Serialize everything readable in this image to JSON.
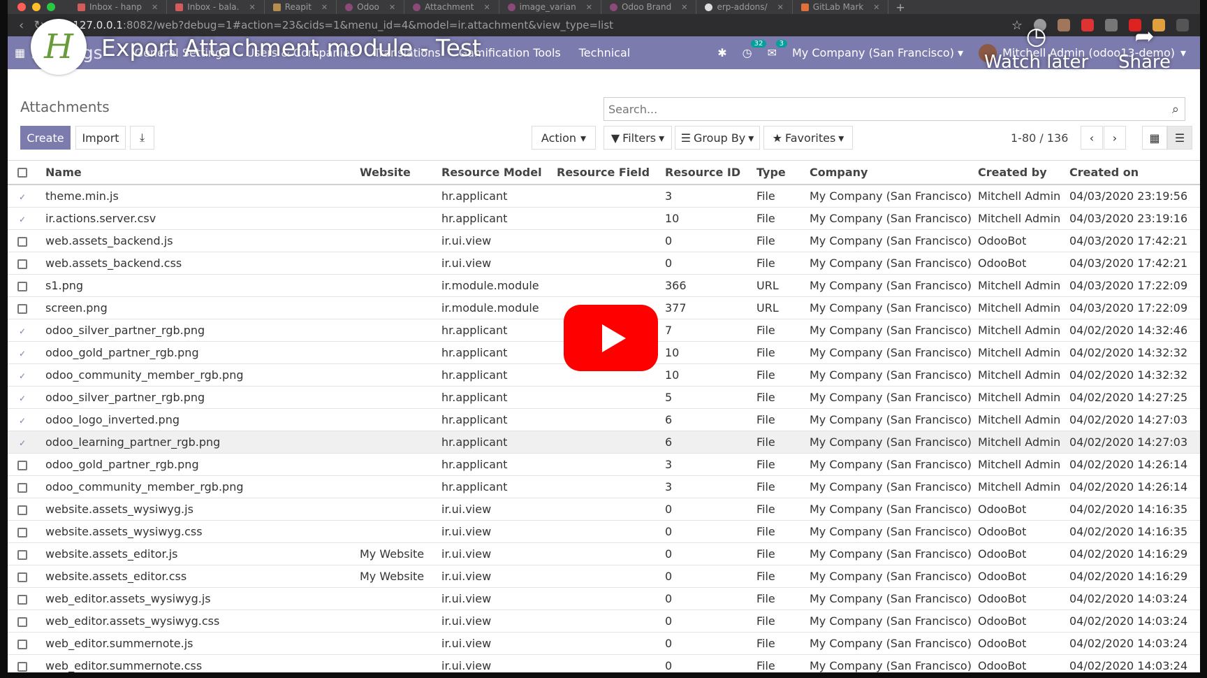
{
  "browser": {
    "tabs": [
      "Inbox - hanp",
      "Inbox - bala.",
      "Reapit",
      "Odoo",
      "Attachment",
      "image_varian",
      "Odoo Brand",
      "erp-addons/",
      "GitLab Mark"
    ],
    "url_host": "127.0.0.1",
    "url_rest": ":8082/web?debug=1#action=23&cids=1&menu_id=4&model=ir.attachment&view_type=list"
  },
  "navbar": {
    "brand": "Settings",
    "menu": [
      "General Settings",
      "Users & Companies",
      "Translations",
      "Gamification Tools",
      "Technical"
    ],
    "activity_count": "32",
    "messages_count": "3",
    "company": "My Company (San Francisco)",
    "user": "Mitchell Admin (odoo13-demo)"
  },
  "control_panel": {
    "breadcrumb": "Attachments",
    "search_placeholder": "Search...",
    "create_label": "Create",
    "import_label": "Import",
    "action_label": "Action",
    "filters_label": "Filters",
    "groupby_label": "Group By",
    "favorites_label": "Favorites",
    "pager": "1-80 / 136"
  },
  "table": {
    "columns": [
      "Name",
      "Website",
      "Resource Model",
      "Resource Field",
      "Resource ID",
      "Type",
      "Company",
      "Created by",
      "Created on"
    ],
    "rows": [
      {
        "checked": true,
        "name": "theme.min.js",
        "website": "",
        "model": "hr.applicant",
        "field": "",
        "res_id": "3",
        "type": "File",
        "company": "My Company (San Francisco)",
        "created_by": "Mitchell Admin",
        "created_on": "04/03/2020 23:19:56"
      },
      {
        "checked": true,
        "name": "ir.actions.server.csv",
        "website": "",
        "model": "hr.applicant",
        "field": "",
        "res_id": "10",
        "type": "File",
        "company": "My Company (San Francisco)",
        "created_by": "Mitchell Admin",
        "created_on": "04/03/2020 23:19:16"
      },
      {
        "checked": false,
        "name": "web.assets_backend.js",
        "website": "",
        "model": "ir.ui.view",
        "field": "",
        "res_id": "0",
        "type": "File",
        "company": "My Company (San Francisco)",
        "created_by": "OdooBot",
        "created_on": "04/03/2020 17:42:21"
      },
      {
        "checked": false,
        "name": "web.assets_backend.css",
        "website": "",
        "model": "ir.ui.view",
        "field": "",
        "res_id": "0",
        "type": "File",
        "company": "My Company (San Francisco)",
        "created_by": "OdooBot",
        "created_on": "04/03/2020 17:42:21"
      },
      {
        "checked": false,
        "name": "s1.png",
        "website": "",
        "model": "ir.module.module",
        "field": "",
        "res_id": "366",
        "type": "URL",
        "company": "My Company (San Francisco)",
        "created_by": "Mitchell Admin",
        "created_on": "04/03/2020 17:22:09"
      },
      {
        "checked": false,
        "name": "screen.png",
        "website": "",
        "model": "ir.module.module",
        "field": "",
        "res_id": "377",
        "type": "URL",
        "company": "My Company (San Francisco)",
        "created_by": "Mitchell Admin",
        "created_on": "04/03/2020 17:22:09"
      },
      {
        "checked": true,
        "name": "odoo_silver_partner_rgb.png",
        "website": "",
        "model": "hr.applicant",
        "field": "",
        "res_id": "7",
        "type": "File",
        "company": "My Company (San Francisco)",
        "created_by": "Mitchell Admin",
        "created_on": "04/02/2020 14:32:46"
      },
      {
        "checked": true,
        "name": "odoo_gold_partner_rgb.png",
        "website": "",
        "model": "hr.applicant",
        "field": "",
        "res_id": "10",
        "type": "File",
        "company": "My Company (San Francisco)",
        "created_by": "Mitchell Admin",
        "created_on": "04/02/2020 14:32:32"
      },
      {
        "checked": true,
        "name": "odoo_community_member_rgb.png",
        "website": "",
        "model": "hr.applicant",
        "field": "",
        "res_id": "10",
        "type": "File",
        "company": "My Company (San Francisco)",
        "created_by": "Mitchell Admin",
        "created_on": "04/02/2020 14:32:32"
      },
      {
        "checked": true,
        "name": "odoo_silver_partner_rgb.png",
        "website": "",
        "model": "hr.applicant",
        "field": "",
        "res_id": "5",
        "type": "File",
        "company": "My Company (San Francisco)",
        "created_by": "Mitchell Admin",
        "created_on": "04/02/2020 14:27:25"
      },
      {
        "checked": true,
        "name": "odoo_logo_inverted.png",
        "website": "",
        "model": "hr.applicant",
        "field": "",
        "res_id": "6",
        "type": "File",
        "company": "My Company (San Francisco)",
        "created_by": "Mitchell Admin",
        "created_on": "04/02/2020 14:27:03"
      },
      {
        "checked": true,
        "name": "odoo_learning_partner_rgb.png",
        "website": "",
        "model": "hr.applicant",
        "field": "",
        "res_id": "6",
        "type": "File",
        "company": "My Company (San Francisco)",
        "created_by": "Mitchell Admin",
        "created_on": "04/02/2020 14:27:03"
      },
      {
        "checked": false,
        "name": "odoo_gold_partner_rgb.png",
        "website": "",
        "model": "hr.applicant",
        "field": "",
        "res_id": "3",
        "type": "File",
        "company": "My Company (San Francisco)",
        "created_by": "Mitchell Admin",
        "created_on": "04/02/2020 14:26:14"
      },
      {
        "checked": false,
        "name": "odoo_community_member_rgb.png",
        "website": "",
        "model": "hr.applicant",
        "field": "",
        "res_id": "3",
        "type": "File",
        "company": "My Company (San Francisco)",
        "created_by": "Mitchell Admin",
        "created_on": "04/02/2020 14:26:14"
      },
      {
        "checked": false,
        "name": "website.assets_wysiwyg.js",
        "website": "",
        "model": "ir.ui.view",
        "field": "",
        "res_id": "0",
        "type": "File",
        "company": "My Company (San Francisco)",
        "created_by": "OdooBot",
        "created_on": "04/02/2020 14:16:35"
      },
      {
        "checked": false,
        "name": "website.assets_wysiwyg.css",
        "website": "",
        "model": "ir.ui.view",
        "field": "",
        "res_id": "0",
        "type": "File",
        "company": "My Company (San Francisco)",
        "created_by": "OdooBot",
        "created_on": "04/02/2020 14:16:35"
      },
      {
        "checked": false,
        "name": "website.assets_editor.js",
        "website": "My Website",
        "model": "ir.ui.view",
        "field": "",
        "res_id": "0",
        "type": "File",
        "company": "My Company (San Francisco)",
        "created_by": "OdooBot",
        "created_on": "04/02/2020 14:16:29"
      },
      {
        "checked": false,
        "name": "website.assets_editor.css",
        "website": "My Website",
        "model": "ir.ui.view",
        "field": "",
        "res_id": "0",
        "type": "File",
        "company": "My Company (San Francisco)",
        "created_by": "OdooBot",
        "created_on": "04/02/2020 14:16:29"
      },
      {
        "checked": false,
        "name": "web_editor.assets_wysiwyg.js",
        "website": "",
        "model": "ir.ui.view",
        "field": "",
        "res_id": "0",
        "type": "File",
        "company": "My Company (San Francisco)",
        "created_by": "OdooBot",
        "created_on": "04/02/2020 14:03:24"
      },
      {
        "checked": false,
        "name": "web_editor.assets_wysiwyg.css",
        "website": "",
        "model": "ir.ui.view",
        "field": "",
        "res_id": "0",
        "type": "File",
        "company": "My Company (San Francisco)",
        "created_by": "OdooBot",
        "created_on": "04/02/2020 14:03:24"
      },
      {
        "checked": false,
        "name": "web_editor.summernote.js",
        "website": "",
        "model": "ir.ui.view",
        "field": "",
        "res_id": "0",
        "type": "File",
        "company": "My Company (San Francisco)",
        "created_by": "OdooBot",
        "created_on": "04/02/2020 14:03:24"
      },
      {
        "checked": false,
        "name": "web_editor.summernote.css",
        "website": "",
        "model": "ir.ui.view",
        "field": "",
        "res_id": "0",
        "type": "File",
        "company": "My Company (San Francisco)",
        "created_by": "OdooBot",
        "created_on": "04/02/2020 14:03:24"
      }
    ]
  },
  "video": {
    "title": "Export Attachment module - Test",
    "watch_later": "Watch later",
    "share": "Share"
  },
  "colors": {
    "brand": "#7c7bad",
    "play": "#ff0000"
  }
}
